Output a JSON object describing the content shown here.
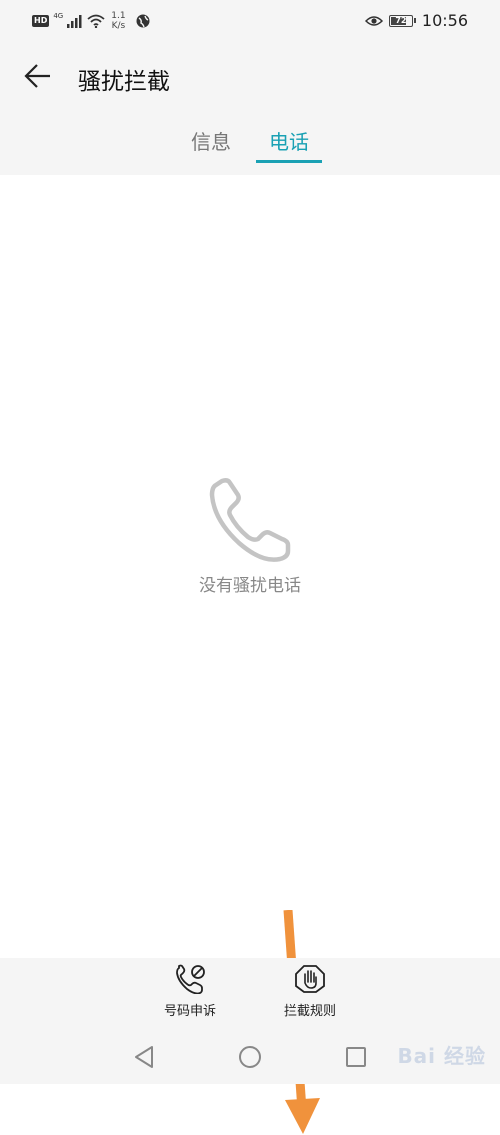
{
  "status_bar": {
    "hd": "HD",
    "network": "4G",
    "speed_value": "1.1",
    "speed_unit": "K/s",
    "battery": "72",
    "time": "10:56"
  },
  "header": {
    "title": "骚扰拦截"
  },
  "tabs": [
    {
      "label": "信息",
      "active": false
    },
    {
      "label": "电话",
      "active": true
    }
  ],
  "empty_state": {
    "icon": "phone-icon",
    "message": "没有骚扰电话"
  },
  "actions": [
    {
      "label": "号码申诉",
      "icon": "phone-block-icon"
    },
    {
      "label": "拦截规则",
      "icon": "hand-stop-icon"
    }
  ],
  "watermark": "Bai 经验",
  "colors": {
    "accent": "#1aa1b4",
    "arrow": "#f0923c",
    "bar_background": "#f5f5f5"
  }
}
